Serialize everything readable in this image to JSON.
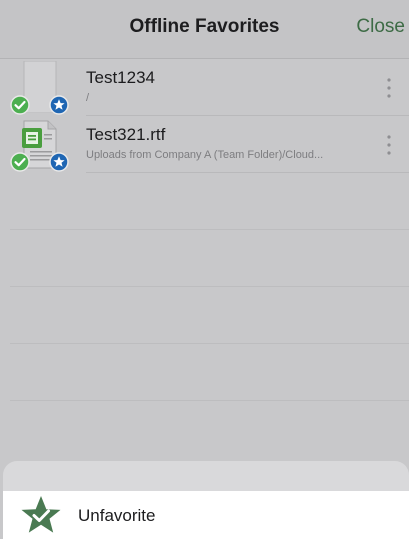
{
  "navbar": {
    "title": "Offline Favorites",
    "close_label": "Close"
  },
  "files": [
    {
      "name": "Test1234",
      "path": "/",
      "icon": "blank-document-icon",
      "synced": true,
      "favorited": true
    },
    {
      "name": "Test321.rtf",
      "path": "Uploads from Company A (Team Folder)/Cloud...",
      "icon": "rtf-document-icon",
      "synced": true,
      "favorited": true
    }
  ],
  "action_sheet": {
    "action_label": "Unfavorite",
    "action_icon": "unfavorite-star-icon"
  },
  "colors": {
    "accent_green": "#3d6b45",
    "check_green": "#4caf50",
    "star_blue": "#1f66b3",
    "star_icon_green": "#4a7a52"
  }
}
